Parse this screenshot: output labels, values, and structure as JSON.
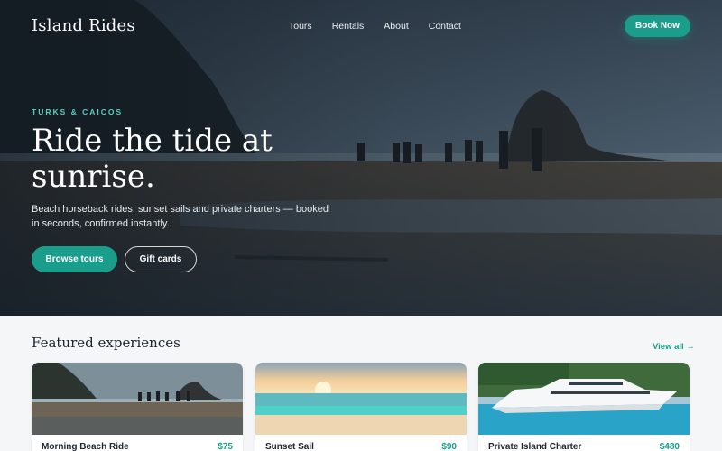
{
  "brand": {
    "name": "Island Rides"
  },
  "nav": {
    "links": [
      "Tours",
      "Rentals",
      "About",
      "Contact"
    ],
    "cta_label": "Book Now"
  },
  "hero": {
    "eyebrow": "TURKS & CAICOS",
    "headline": "Ride the tide at sunrise.",
    "subtext": "Beach horseback rides, sunset sails and private charters — booked in seconds, confirmed instantly.",
    "primary_label": "Browse tours",
    "secondary_label": "Gift cards"
  },
  "featured": {
    "title": "Featured experiences",
    "view_all_label": "View all →",
    "cards": [
      {
        "title": "Morning Beach Ride",
        "price": "$75"
      },
      {
        "title": "Sunset Sail",
        "price": "$90"
      },
      {
        "title": "Private Island Charter",
        "price": "$480"
      }
    ]
  },
  "colors": {
    "accent": "#1a9e8b",
    "accent_light": "#4fd3bf",
    "page_bg": "#f4f6f8",
    "heading": "#1c2530"
  }
}
